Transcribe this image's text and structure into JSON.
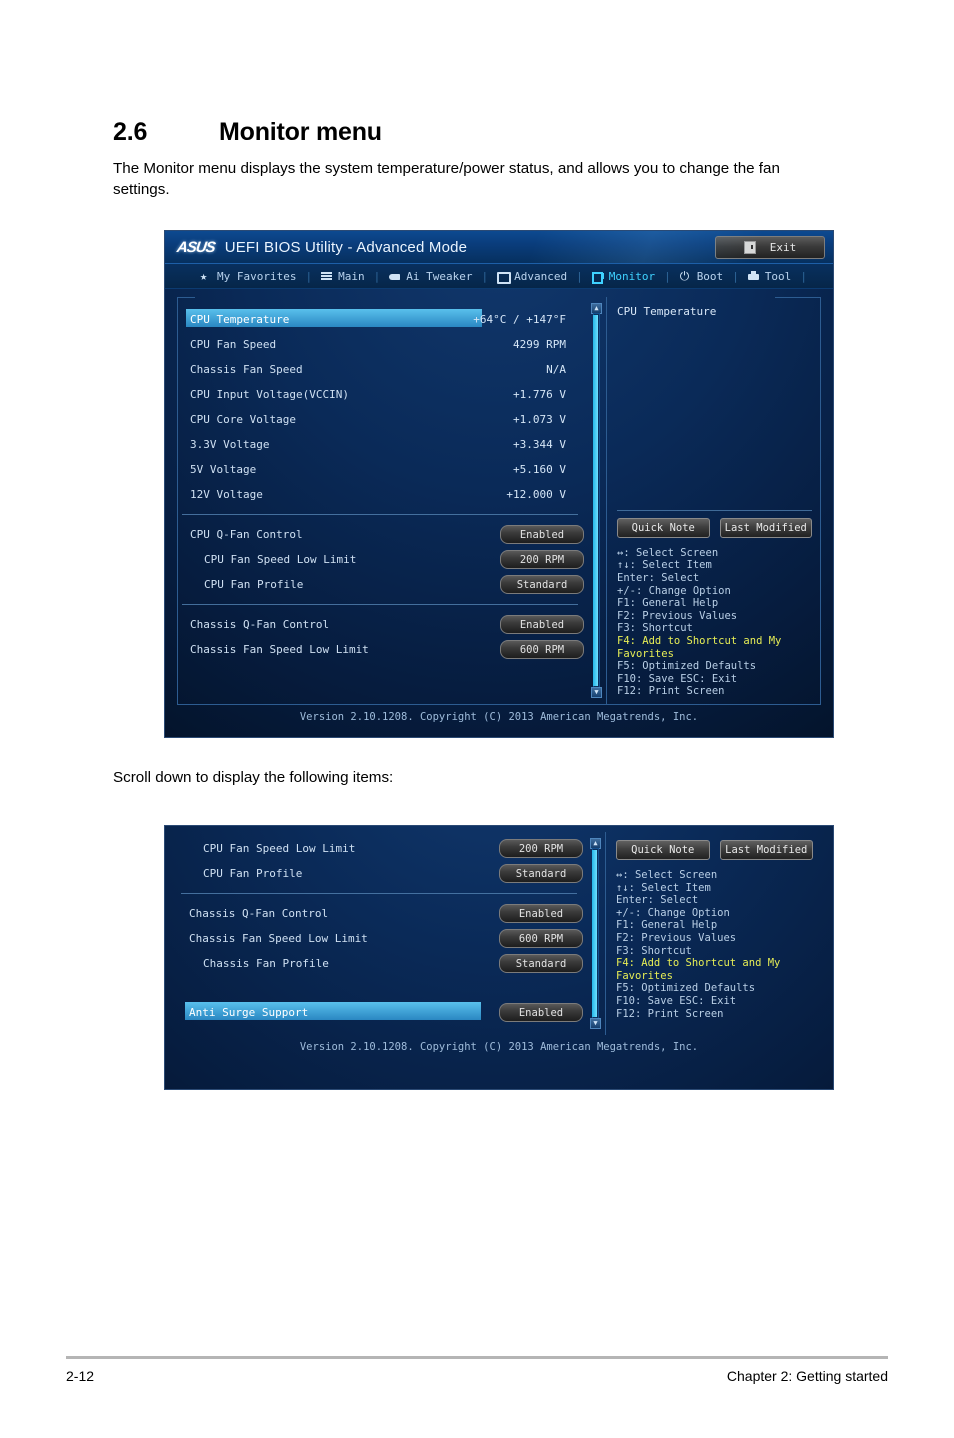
{
  "document": {
    "section_number": "2.6",
    "section_title": "Monitor menu",
    "intro": "The Monitor menu displays the system temperature/power status, and allows you to change the fan settings.",
    "scroll_note": "Scroll down to display the following items:",
    "footer_left": "2-12",
    "footer_right": "Chapter 2: Getting started"
  },
  "bios": {
    "title": "UEFI BIOS Utility - Advanced Mode",
    "logo": "ASUS",
    "exit_label": "Exit",
    "exit_icon": "exit-door-icon",
    "version": "Version 2.10.1208. Copyright (C) 2013 American Megatrends, Inc.",
    "accent_active": "#3fd2ff",
    "accent_highlight": "#e7ee55",
    "tabs": [
      {
        "label": "My Favorites",
        "icon": "star-icon",
        "active": false
      },
      {
        "label": "Main",
        "icon": "list-icon",
        "active": false
      },
      {
        "label": "Ai Tweaker",
        "icon": "tweaker-icon",
        "active": false
      },
      {
        "label": "Advanced",
        "icon": "advanced-icon",
        "active": false
      },
      {
        "label": "Monitor",
        "icon": "monitor-icon",
        "active": true
      },
      {
        "label": "Boot",
        "icon": "power-icon",
        "active": false
      },
      {
        "label": "Tool",
        "icon": "tool-icon",
        "active": false
      }
    ],
    "help_title": "CPU Temperature",
    "buttons": {
      "quick_note": "Quick Note",
      "last_modified": "Last Modified"
    },
    "keys": [
      {
        "text": "↔: Select Screen",
        "highlight": false
      },
      {
        "text": "↑↓: Select Item",
        "highlight": false
      },
      {
        "text": "Enter: Select",
        "highlight": false
      },
      {
        "text": "+/-: Change Option",
        "highlight": false
      },
      {
        "text": "F1: General Help",
        "highlight": false
      },
      {
        "text": "F2: Previous Values",
        "highlight": false
      },
      {
        "text": "F3: Shortcut",
        "highlight": false
      },
      {
        "text": "F4: Add to Shortcut and My Favorites",
        "highlight": true
      },
      {
        "text": "F5: Optimized Defaults",
        "highlight": false
      },
      {
        "text": "F10: Save  ESC: Exit",
        "highlight": false
      },
      {
        "text": "F12: Print Screen",
        "highlight": false
      }
    ],
    "screen1_items": [
      {
        "label": "CPU Temperature",
        "value": "+64°C / +147°F",
        "type": "readonly",
        "selected": true,
        "indent": false
      },
      {
        "label": "CPU Fan Speed",
        "value": "4299 RPM",
        "type": "readonly",
        "selected": false,
        "indent": false
      },
      {
        "label": "Chassis Fan Speed",
        "value": "N/A",
        "type": "readonly",
        "selected": false,
        "indent": false
      },
      {
        "label": "CPU Input Voltage(VCCIN)",
        "value": "+1.776 V",
        "type": "readonly",
        "selected": false,
        "indent": false
      },
      {
        "label": "CPU Core Voltage",
        "value": "+1.073 V",
        "type": "readonly",
        "selected": false,
        "indent": false
      },
      {
        "label": "3.3V Voltage",
        "value": "+3.344 V",
        "type": "readonly",
        "selected": false,
        "indent": false
      },
      {
        "label": "5V Voltage",
        "value": "+5.160 V",
        "type": "readonly",
        "selected": false,
        "indent": false
      },
      {
        "label": "12V Voltage",
        "value": "+12.000 V",
        "type": "readonly",
        "selected": false,
        "indent": false
      },
      {
        "divider": true
      },
      {
        "label": "CPU Q-Fan Control",
        "value": "Enabled",
        "type": "option",
        "selected": false,
        "indent": false
      },
      {
        "label": "CPU Fan Speed Low Limit",
        "value": "200 RPM",
        "type": "option",
        "selected": false,
        "indent": true
      },
      {
        "label": "CPU Fan Profile",
        "value": "Standard",
        "type": "option",
        "selected": false,
        "indent": true
      },
      {
        "divider": true
      },
      {
        "label": "Chassis Q-Fan Control",
        "value": "Enabled",
        "type": "option",
        "selected": false,
        "indent": false
      },
      {
        "label": "Chassis Fan Speed Low Limit",
        "value": "600 RPM",
        "type": "option",
        "selected": false,
        "indent": false
      }
    ],
    "screen2_items": [
      {
        "label": "CPU Fan Speed Low Limit",
        "value": "200 RPM",
        "type": "option",
        "selected": false,
        "indent": true
      },
      {
        "label": "CPU Fan Profile",
        "value": "Standard",
        "type": "option",
        "selected": false,
        "indent": true
      },
      {
        "divider": true
      },
      {
        "label": "Chassis Q-Fan Control",
        "value": "Enabled",
        "type": "option",
        "selected": false,
        "indent": false
      },
      {
        "label": "Chassis Fan Speed Low Limit",
        "value": "600 RPM",
        "type": "option",
        "selected": false,
        "indent": false
      },
      {
        "label": "Chassis Fan Profile",
        "value": "Standard",
        "type": "option",
        "selected": false,
        "indent": true
      },
      {
        "spacer": true
      },
      {
        "label": "Anti Surge Support",
        "value": "Enabled",
        "type": "option",
        "selected": true,
        "indent": false
      }
    ]
  }
}
